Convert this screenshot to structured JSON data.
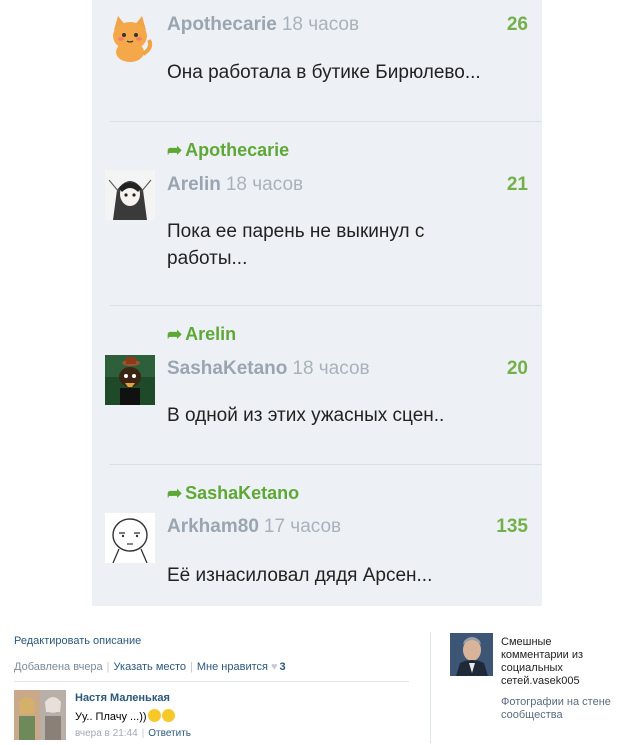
{
  "comments": [
    {
      "author": "Apothecarie",
      "time": "18 часов",
      "likes": "26",
      "text": "Она работала в бутике Бирюлево...",
      "reply_to": ""
    },
    {
      "author": "Arelin",
      "time": "18 часов",
      "likes": "21",
      "text": "Пока ее парень не выкинул с работы...",
      "reply_to": "Apothecarie"
    },
    {
      "author": "SashaKetano",
      "time": "18 часов",
      "likes": "20",
      "text": "В одной из этих ужасных сцен..",
      "reply_to": "Arelin"
    },
    {
      "author": "Arkham80",
      "time": "17 часов",
      "likes": "135",
      "text": "Её изнасиловал дядя Арсен...",
      "reply_to": "SashaKetano"
    }
  ],
  "reply_arrow": "➦",
  "post": {
    "edit_description": "Редактировать описание",
    "added": "Добавлена вчера",
    "add_place": "Указать место",
    "like_label": "Мне нравится",
    "like_count": "3"
  },
  "photo_comment": {
    "author": "Настя Маленькая",
    "text": "Уу.. Плачу ...))",
    "time": "вчера в 21:44",
    "reply_label": "Ответить"
  },
  "album": {
    "title": "Смешные комментарии из социальных сетей.vasek005",
    "subtitle": "Фотографии на стене сообщества"
  },
  "colors": {
    "card_bg": "#edf1f5",
    "likes_green": "#74b04a",
    "reply_green": "#5ea836",
    "vk_link": "#2b587a"
  }
}
